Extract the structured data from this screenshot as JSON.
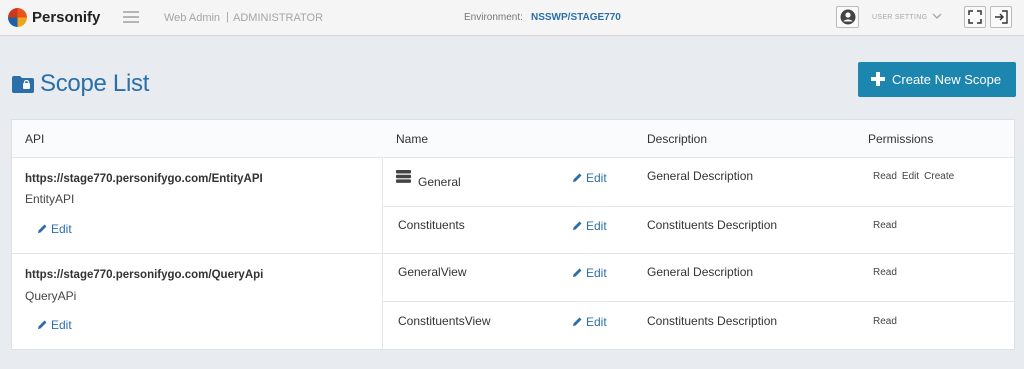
{
  "topbar": {
    "brand": "Personify",
    "web_admin": "Web Admin",
    "separator": "|",
    "role": "ADMINISTRATOR",
    "environment_label": "Environment:",
    "environment_value": "NSSWP/STAGE770",
    "user_setting": "USER SETTING"
  },
  "page": {
    "title": "Scope List",
    "create_button": "Create New Scope"
  },
  "table": {
    "headers": {
      "api": "API",
      "name": "Name",
      "description": "Description",
      "permissions": "Permissions"
    },
    "apis": [
      {
        "url": "https://stage770.personifygo.com/EntityAPI",
        "name": "EntityAPI",
        "edit": "Edit",
        "scopes": [
          {
            "name": "General",
            "edit": "Edit",
            "description": "General Description",
            "permissions": [
              "Read",
              "Edit",
              "Create"
            ]
          },
          {
            "name": "Constituents",
            "edit": "Edit",
            "description": "Constituents Description",
            "permissions": [
              "Read"
            ]
          }
        ]
      },
      {
        "url": "https://stage770.personifygo.com/QueryApi",
        "name": "QueryAPi",
        "edit": "Edit",
        "scopes": [
          {
            "name": "GeneralView",
            "edit": "Edit",
            "description": "General Description",
            "permissions": [
              "Read"
            ]
          },
          {
            "name": "ConstituentsView",
            "edit": "Edit",
            "description": "Constituents Description",
            "permissions": [
              "Read"
            ]
          }
        ]
      }
    ]
  },
  "colors": {
    "accent": "#1c86ae",
    "link": "#2b6faa",
    "title": "#2a6fa8",
    "background": "#e8ecf1"
  }
}
